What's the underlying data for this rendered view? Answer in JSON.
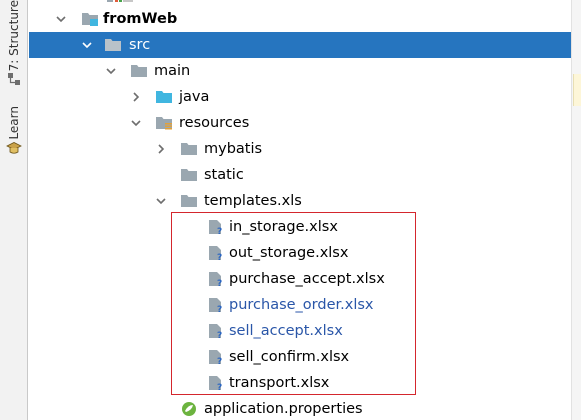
{
  "tool_strip": {
    "structure_label": "7: Structure",
    "learn_label": "Learn"
  },
  "tree": {
    "rows": [
      {
        "label": "fromWeb",
        "icon": "module-folder-icon",
        "expanded": true
      },
      {
        "label": "src",
        "icon": "folder-icon",
        "expanded": true,
        "selected": true
      },
      {
        "label": "main",
        "icon": "folder-icon",
        "expanded": true
      },
      {
        "label": "java",
        "icon": "source-folder-icon",
        "expanded": false
      },
      {
        "label": "resources",
        "icon": "resources-folder-icon",
        "expanded": true
      },
      {
        "label": "mybatis",
        "icon": "folder-icon",
        "expanded": false
      },
      {
        "label": "static",
        "icon": "folder-icon"
      },
      {
        "label": "templates.xls",
        "icon": "folder-icon",
        "expanded": true
      },
      {
        "label": "in_storage.xlsx",
        "icon": "unknown-file-icon"
      },
      {
        "label": "out_storage.xlsx",
        "icon": "unknown-file-icon"
      },
      {
        "label": "purchase_accept.xlsx",
        "icon": "unknown-file-icon"
      },
      {
        "label": "purchase_order.xlsx",
        "icon": "unknown-file-icon",
        "vcs_status": "modified"
      },
      {
        "label": "sell_accept.xlsx",
        "icon": "unknown-file-icon",
        "vcs_status": "modified"
      },
      {
        "label": "sell_confirm.xlsx",
        "icon": "unknown-file-icon"
      },
      {
        "label": "transport.xlsx",
        "icon": "unknown-file-icon"
      },
      {
        "label": "application.properties",
        "icon": "spring-properties-icon"
      }
    ]
  },
  "colors": {
    "selection": "#2675bf",
    "highlight_border": "#d4262d",
    "modified_text": "#2a56a8",
    "folder": "#9aa7b0",
    "source_folder": "#40b6e0"
  }
}
